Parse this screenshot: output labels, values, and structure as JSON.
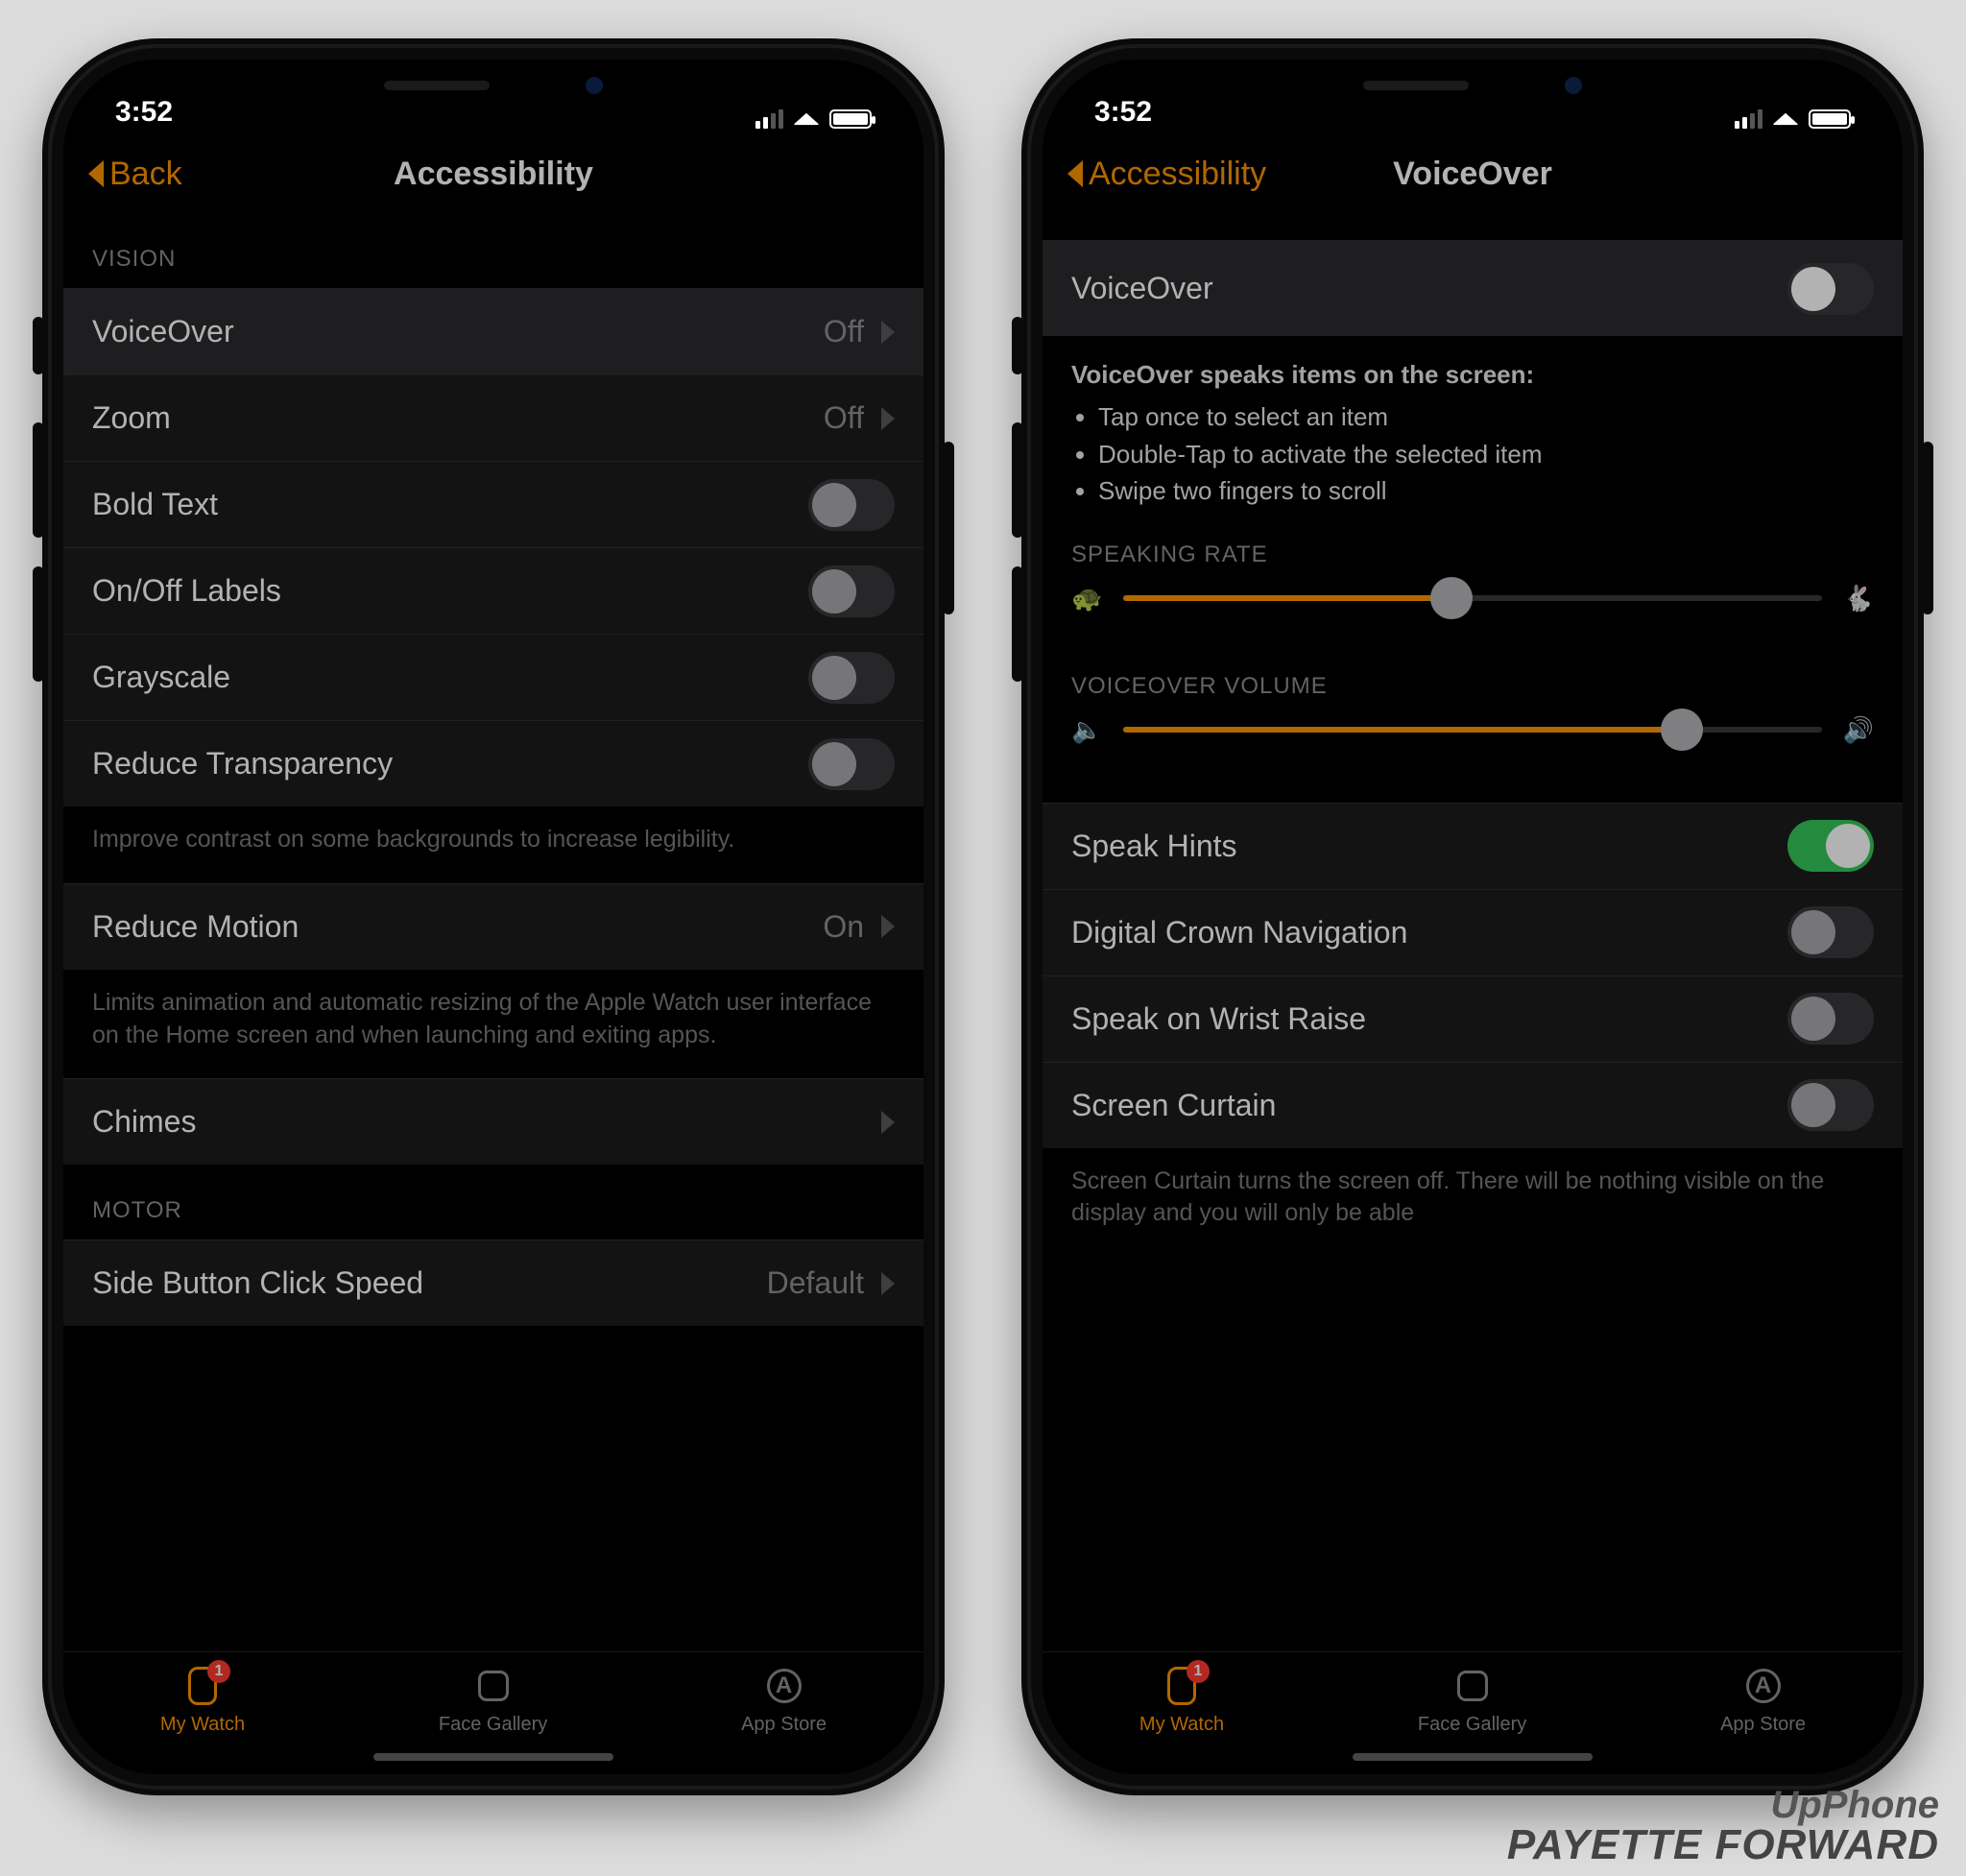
{
  "status": {
    "time": "3:52"
  },
  "left": {
    "back": "Back",
    "title": "Accessibility",
    "section_vision": "VISION",
    "voiceover": {
      "label": "VoiceOver",
      "value": "Off"
    },
    "zoom": {
      "label": "Zoom",
      "value": "Off"
    },
    "bold": {
      "label": "Bold Text"
    },
    "onoff": {
      "label": "On/Off Labels"
    },
    "gray": {
      "label": "Grayscale"
    },
    "reduce_trans": {
      "label": "Reduce Transparency"
    },
    "reduce_trans_foot": "Improve contrast on some backgrounds to increase legibility.",
    "reduce_motion": {
      "label": "Reduce Motion",
      "value": "On"
    },
    "reduce_motion_foot": "Limits animation and automatic resizing of the Apple Watch user interface on the Home screen and when launching and exiting apps.",
    "chimes": {
      "label": "Chimes"
    },
    "section_motor": "MOTOR",
    "side_button": {
      "label": "Side Button Click Speed",
      "value": "Default"
    }
  },
  "tabs": {
    "my_watch": "My Watch",
    "face_gallery": "Face Gallery",
    "app_store": "App Store",
    "astore_letter": "A",
    "badge": "1"
  },
  "right": {
    "back": "Accessibility",
    "title": "VoiceOver",
    "toggle": {
      "label": "VoiceOver"
    },
    "desc_head": "VoiceOver speaks items on the screen:",
    "desc_items": [
      "Tap once to select an item",
      "Double-Tap to activate the selected item",
      "Swipe two fingers to scroll"
    ],
    "speaking_rate": "SPEAKING RATE",
    "vo_volume": "VOICEOVER VOLUME",
    "turtle": "🐢",
    "rabbit": "🐇",
    "vol_low": "🔈",
    "vol_high": "🔊",
    "speak_hints": "Speak Hints",
    "crown": "Digital Crown Navigation",
    "wrist": "Speak on Wrist Raise",
    "curtain": "Screen Curtain",
    "curtain_foot": "Screen Curtain turns the screen off. There will be nothing visible on the display and you will only be able"
  },
  "watermark": {
    "l1": "UpPhone",
    "l2": "PAYETTE FORWARD"
  }
}
